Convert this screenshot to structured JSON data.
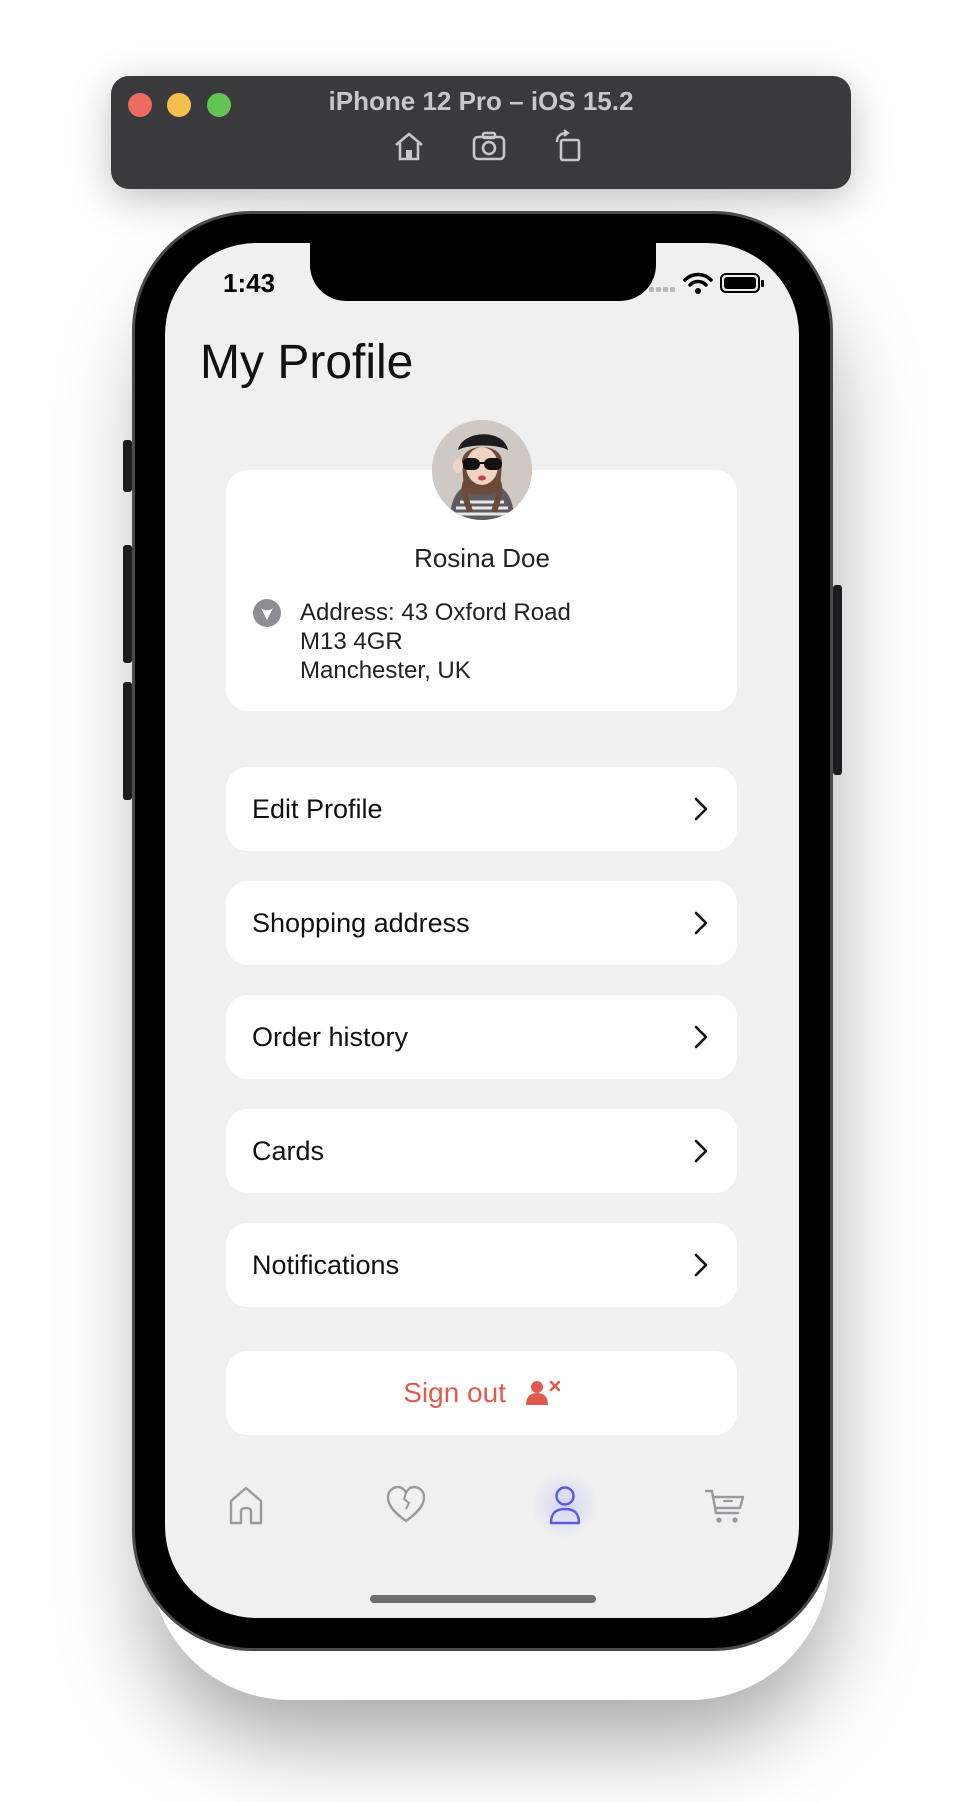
{
  "simulator": {
    "title": "iPhone 12 Pro – iOS 15.2",
    "tools": [
      "home-icon",
      "screenshot-icon",
      "rotate-icon"
    ]
  },
  "status_bar": {
    "time": "1:43"
  },
  "profile": {
    "page_title": "My Profile",
    "name": "Rosina Doe",
    "address_lines": [
      "Address: 43 Oxford Road",
      "M13 4GR",
      "Manchester, UK"
    ]
  },
  "menu": {
    "items": [
      {
        "label": "Edit Profile"
      },
      {
        "label": "Shopping address"
      },
      {
        "label": "Order history"
      },
      {
        "label": "Cards"
      },
      {
        "label": "Notifications"
      }
    ]
  },
  "signout": {
    "label": "Sign out",
    "color": "#e05a50"
  },
  "tab_bar": {
    "tabs": [
      "home-icon",
      "heart-icon",
      "profile-icon",
      "cart-icon"
    ],
    "active": "profile-icon",
    "active_color": "#5a5ae6",
    "inactive_color": "#9a9a9e"
  }
}
